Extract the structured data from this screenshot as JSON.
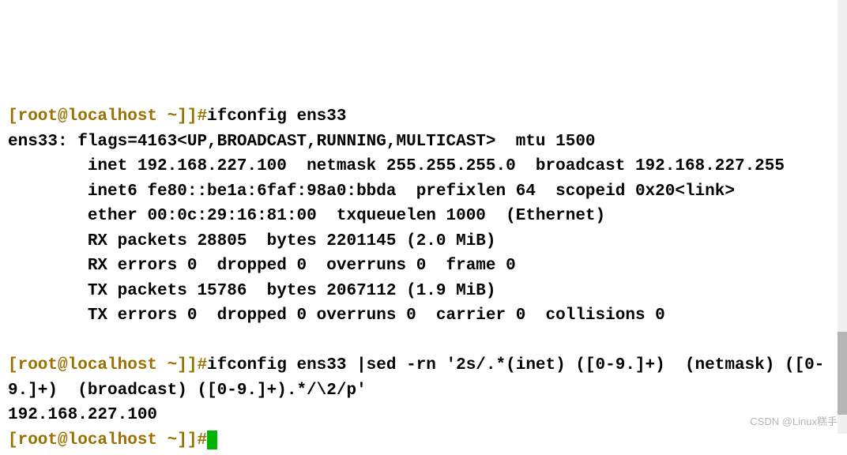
{
  "prompt1": "[root@localhost ~]]#",
  "command1": "ifconfig ens33",
  "output1_line1": "ens33: flags=4163<UP,BROADCAST,RUNNING,MULTICAST>  mtu 1500",
  "output1_line2": "        inet 192.168.227.100  netmask 255.255.255.0  broadcast 192.168.227.255",
  "output1_line3": "        inet6 fe80::be1a:6faf:98a0:bbda  prefixlen 64  scopeid 0x20<link>",
  "output1_line4": "        ether 00:0c:29:16:81:00  txqueuelen 1000  (Ethernet)",
  "output1_line5": "        RX packets 28805  bytes 2201145 (2.0 MiB)",
  "output1_line6": "        RX errors 0  dropped 0  overruns 0  frame 0",
  "output1_line7": "        TX packets 15786  bytes 2067112 (1.9 MiB)",
  "output1_line8": "        TX errors 0  dropped 0 overruns 0  carrier 0  collisions 0",
  "blank1": "",
  "prompt2": "[root@localhost ~]]#",
  "command2": "ifconfig ens33 |sed -rn '2s/.*(inet) ([0-9.]+)  (netmask) ([0-9.]+)  (broadcast) ([0-9.]+).*/\\2/p'",
  "output2_line1": "192.168.227.100",
  "prompt3": "[root@localhost ~]]#",
  "watermark": "CSDN @Linux糕手"
}
